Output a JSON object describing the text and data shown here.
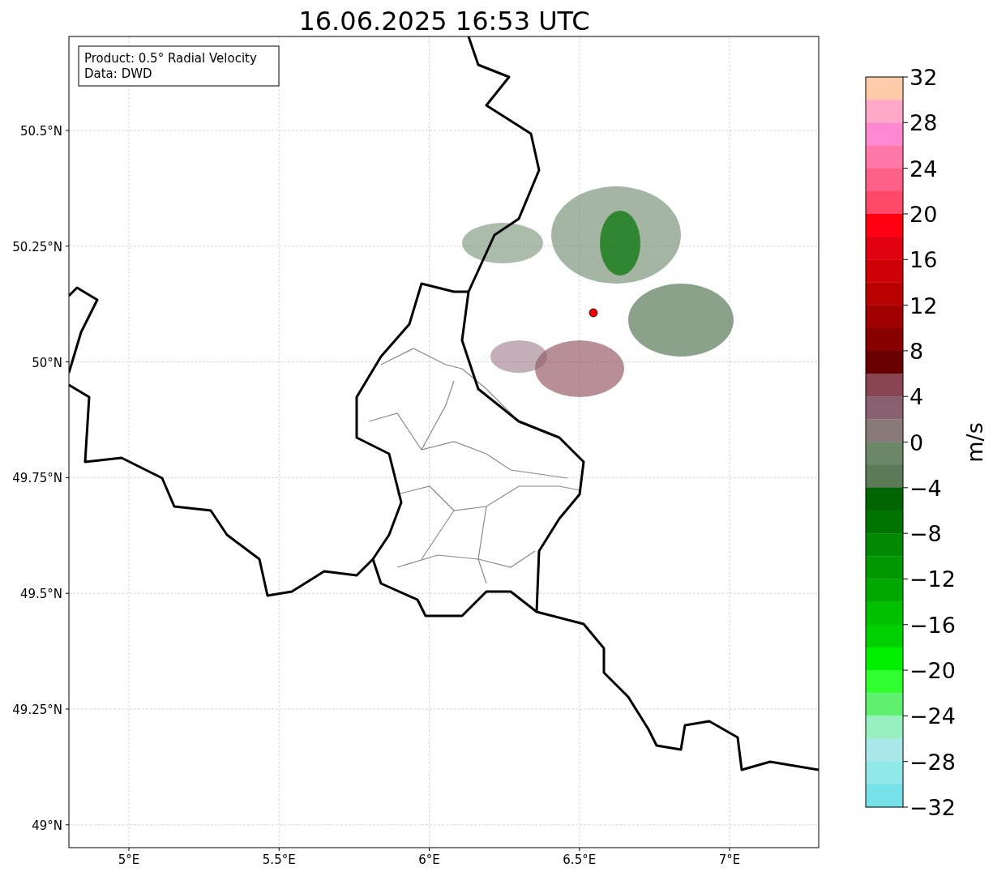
{
  "title": "16.06.2025 16:53 UTC",
  "legend": {
    "lines": [
      "Product: 0.5° Radial Velocity",
      "Data: DWD"
    ]
  },
  "xticks": [
    {
      "label": "5°E"
    },
    {
      "label": "5.5°E"
    },
    {
      "label": "6°E"
    },
    {
      "label": "6.5°E"
    },
    {
      "label": "7°E"
    }
  ],
  "yticks": [
    {
      "label": "50.5°N"
    },
    {
      "label": "50.25°N"
    },
    {
      "label": "50°N"
    },
    {
      "label": "49.75°N"
    },
    {
      "label": "49.5°N"
    },
    {
      "label": "49.25°N"
    },
    {
      "label": "49°N"
    }
  ],
  "colorbar": {
    "label": "m/s",
    "segments": [
      {
        "color": "#ffcba8"
      },
      {
        "color": "#ffa8c8"
      },
      {
        "color": "#ff88d0"
      },
      {
        "color": "#ff78a8"
      },
      {
        "color": "#ff6088"
      },
      {
        "color": "#ff4868"
      },
      {
        "color": "#ff0010"
      },
      {
        "color": "#e00010"
      },
      {
        "color": "#d00008"
      },
      {
        "color": "#b80000"
      },
      {
        "color": "#a00000"
      },
      {
        "color": "#880000"
      },
      {
        "color": "#680000"
      },
      {
        "color": "#884450"
      },
      {
        "color": "#886070"
      },
      {
        "color": "#887878"
      },
      {
        "color": "#6a8868"
      },
      {
        "color": "#5a7a58"
      },
      {
        "color": "#006400"
      },
      {
        "color": "#007400"
      },
      {
        "color": "#008800"
      },
      {
        "color": "#009800"
      },
      {
        "color": "#00a800"
      },
      {
        "color": "#00c000"
      },
      {
        "color": "#00d000"
      },
      {
        "color": "#00f000"
      },
      {
        "color": "#30ff30"
      },
      {
        "color": "#60f070"
      },
      {
        "color": "#98f0c0"
      },
      {
        "color": "#a8e8e8"
      },
      {
        "color": "#90e8e8"
      },
      {
        "color": "#78e0e8"
      }
    ],
    "ticks": [
      "32",
      "28",
      "24",
      "20",
      "16",
      "12",
      "8",
      "4",
      "0",
      "−4",
      "−8",
      "−12",
      "−16",
      "−20",
      "−24",
      "−28",
      "−32"
    ]
  }
}
